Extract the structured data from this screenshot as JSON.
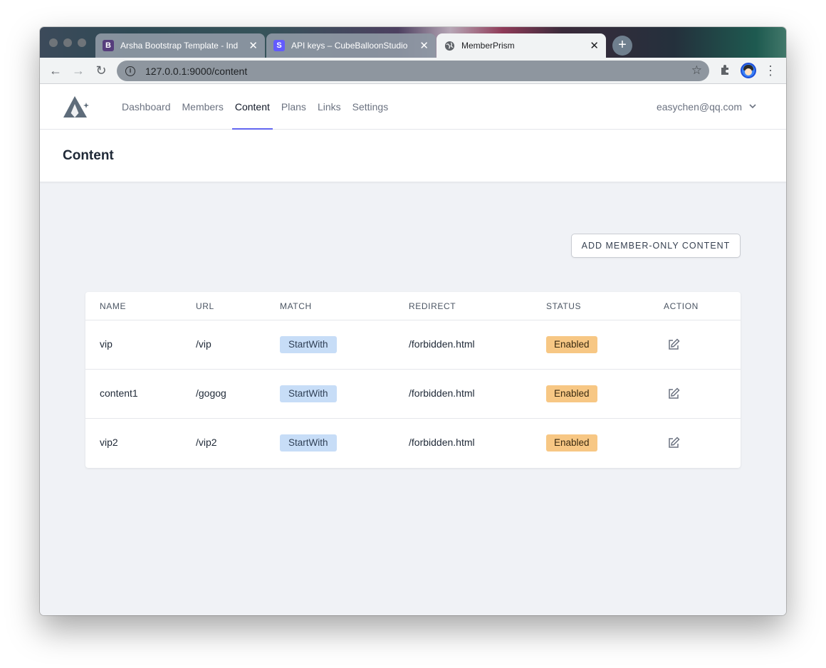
{
  "browser": {
    "tabs": [
      {
        "title": "Arsha Bootstrap Template - Ind",
        "favicon": "B",
        "favicon_color": "#563d7c"
      },
      {
        "title": "API keys – CubeBalloonStudio",
        "favicon": "S",
        "favicon_color": "#635bff"
      },
      {
        "title": "MemberPrism",
        "favicon": "globe-icon"
      }
    ],
    "url": "127.0.0.1:9000/content"
  },
  "nav": {
    "items": [
      "Dashboard",
      "Members",
      "Content",
      "Plans",
      "Links",
      "Settings"
    ],
    "active": "Content",
    "user_email": "easychen@qq.com"
  },
  "page": {
    "title": "Content",
    "add_button": "ADD MEMBER-ONLY CONTENT"
  },
  "table": {
    "columns": [
      "NAME",
      "URL",
      "MATCH",
      "REDIRECT",
      "STATUS",
      "ACTION"
    ],
    "rows": [
      {
        "name": "vip",
        "url": "/vip",
        "match": "StartWith",
        "redirect": "/forbidden.html",
        "status": "Enabled"
      },
      {
        "name": "content1",
        "url": "/gogog",
        "match": "StartWith",
        "redirect": "/forbidden.html",
        "status": "Enabled"
      },
      {
        "name": "vip2",
        "url": "/vip2",
        "match": "StartWith",
        "redirect": "/forbidden.html",
        "status": "Enabled"
      }
    ]
  },
  "colors": {
    "accent": "#6366f1",
    "match_badge": "#c7ddf7",
    "status_badge": "#f7c784"
  }
}
